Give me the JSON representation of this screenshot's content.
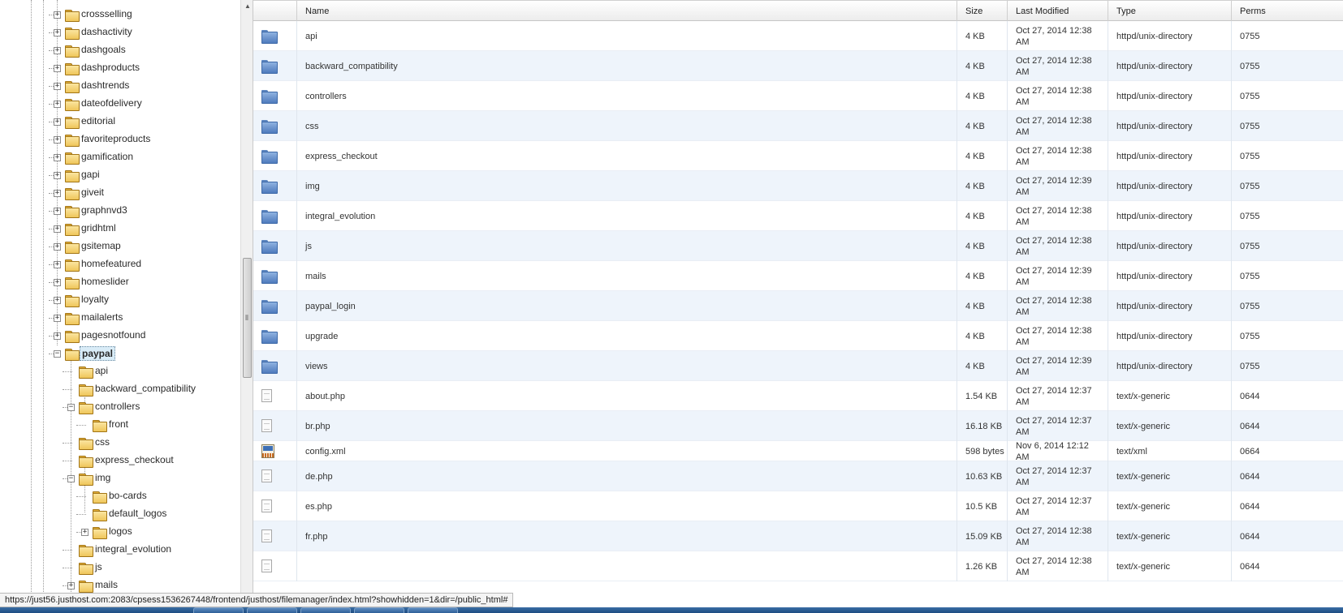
{
  "tree": {
    "items": [
      {
        "label": "crossselling",
        "state": "collapsed"
      },
      {
        "label": "dashactivity",
        "state": "collapsed"
      },
      {
        "label": "dashgoals",
        "state": "collapsed"
      },
      {
        "label": "dashproducts",
        "state": "collapsed"
      },
      {
        "label": "dashtrends",
        "state": "collapsed"
      },
      {
        "label": "dateofdelivery",
        "state": "collapsed"
      },
      {
        "label": "editorial",
        "state": "collapsed"
      },
      {
        "label": "favoriteproducts",
        "state": "collapsed"
      },
      {
        "label": "gamification",
        "state": "collapsed"
      },
      {
        "label": "gapi",
        "state": "collapsed"
      },
      {
        "label": "giveit",
        "state": "collapsed"
      },
      {
        "label": "graphnvd3",
        "state": "collapsed"
      },
      {
        "label": "gridhtml",
        "state": "collapsed"
      },
      {
        "label": "gsitemap",
        "state": "collapsed"
      },
      {
        "label": "homefeatured",
        "state": "collapsed"
      },
      {
        "label": "homeslider",
        "state": "collapsed"
      },
      {
        "label": "loyalty",
        "state": "collapsed"
      },
      {
        "label": "mailalerts",
        "state": "collapsed"
      },
      {
        "label": "pagesnotfound",
        "state": "collapsed"
      },
      {
        "label": "paypal",
        "state": "expanded",
        "selected": true
      },
      {
        "label": "api",
        "state": "leaf"
      },
      {
        "label": "backward_compatibility",
        "state": "leaf"
      },
      {
        "label": "controllers",
        "state": "expanded"
      },
      {
        "label": "front",
        "state": "leaf"
      },
      {
        "label": "css",
        "state": "leaf"
      },
      {
        "label": "express_checkout",
        "state": "leaf"
      },
      {
        "label": "img",
        "state": "expanded"
      },
      {
        "label": "bo-cards",
        "state": "leaf"
      },
      {
        "label": "default_logos",
        "state": "leaf"
      },
      {
        "label": "logos",
        "state": "collapsed"
      },
      {
        "label": "integral_evolution",
        "state": "leaf"
      },
      {
        "label": "js",
        "state": "leaf"
      },
      {
        "label": "mails",
        "state": "collapsed"
      }
    ]
  },
  "table": {
    "columns": {
      "name": "Name",
      "size": "Size",
      "modified": "Last Modified",
      "type": "Type",
      "perms": "Perms"
    },
    "rows": [
      {
        "icon": "blue-folder-icon",
        "name": "api",
        "size": "4 KB",
        "modified": "Oct 27, 2014 12:38 AM",
        "type": "httpd/unix-directory",
        "perms": "0755"
      },
      {
        "icon": "blue-folder-icon",
        "name": "backward_compatibility",
        "size": "4 KB",
        "modified": "Oct 27, 2014 12:38 AM",
        "type": "httpd/unix-directory",
        "perms": "0755"
      },
      {
        "icon": "blue-folder-icon",
        "name": "controllers",
        "size": "4 KB",
        "modified": "Oct 27, 2014 12:38 AM",
        "type": "httpd/unix-directory",
        "perms": "0755"
      },
      {
        "icon": "blue-folder-icon",
        "name": "css",
        "size": "4 KB",
        "modified": "Oct 27, 2014 12:38 AM",
        "type": "httpd/unix-directory",
        "perms": "0755"
      },
      {
        "icon": "blue-folder-icon",
        "name": "express_checkout",
        "size": "4 KB",
        "modified": "Oct 27, 2014 12:38 AM",
        "type": "httpd/unix-directory",
        "perms": "0755"
      },
      {
        "icon": "blue-folder-icon",
        "name": "img",
        "size": "4 KB",
        "modified": "Oct 27, 2014 12:39 AM",
        "type": "httpd/unix-directory",
        "perms": "0755"
      },
      {
        "icon": "blue-folder-icon",
        "name": "integral_evolution",
        "size": "4 KB",
        "modified": "Oct 27, 2014 12:38 AM",
        "type": "httpd/unix-directory",
        "perms": "0755"
      },
      {
        "icon": "blue-folder-icon",
        "name": "js",
        "size": "4 KB",
        "modified": "Oct 27, 2014 12:38 AM",
        "type": "httpd/unix-directory",
        "perms": "0755"
      },
      {
        "icon": "blue-folder-icon",
        "name": "mails",
        "size": "4 KB",
        "modified": "Oct 27, 2014 12:39 AM",
        "type": "httpd/unix-directory",
        "perms": "0755"
      },
      {
        "icon": "blue-folder-icon",
        "name": "paypal_login",
        "size": "4 KB",
        "modified": "Oct 27, 2014 12:38 AM",
        "type": "httpd/unix-directory",
        "perms": "0755"
      },
      {
        "icon": "blue-folder-icon",
        "name": "upgrade",
        "size": "4 KB",
        "modified": "Oct 27, 2014 12:38 AM",
        "type": "httpd/unix-directory",
        "perms": "0755"
      },
      {
        "icon": "blue-folder-icon",
        "name": "views",
        "size": "4 KB",
        "modified": "Oct 27, 2014 12:39 AM",
        "type": "httpd/unix-directory",
        "perms": "0755"
      },
      {
        "icon": "generic-file-icon",
        "name": "about.php",
        "size": "1.54 KB",
        "modified": "Oct 27, 2014 12:37 AM",
        "type": "text/x-generic",
        "perms": "0644"
      },
      {
        "icon": "generic-file-icon",
        "name": "br.php",
        "size": "16.18 KB",
        "modified": "Oct 27, 2014 12:37 AM",
        "type": "text/x-generic",
        "perms": "0644"
      },
      {
        "icon": "xml-file-icon",
        "name": "config.xml",
        "size": "598 bytes",
        "modified": "Nov 6, 2014 12:12 AM",
        "type": "text/xml",
        "perms": "0664",
        "short": true
      },
      {
        "icon": "generic-file-icon",
        "name": "de.php",
        "size": "10.63 KB",
        "modified": "Oct 27, 2014 12:37 AM",
        "type": "text/x-generic",
        "perms": "0644"
      },
      {
        "icon": "generic-file-icon",
        "name": "es.php",
        "size": "10.5 KB",
        "modified": "Oct 27, 2014 12:37 AM",
        "type": "text/x-generic",
        "perms": "0644"
      },
      {
        "icon": "generic-file-icon",
        "name": "fr.php",
        "size": "15.09 KB",
        "modified": "Oct 27, 2014 12:38 AM",
        "type": "text/x-generic",
        "perms": "0644"
      },
      {
        "icon": "generic-file-icon",
        "name": "",
        "size": "1.26 KB",
        "modified": "Oct 27, 2014 12:38 AM",
        "type": "text/x-generic",
        "perms": "0644"
      }
    ]
  },
  "statusbar": {
    "url": "https://just56.justhost.com:2083/cpsess1536267448/frontend/justhost/filemanager/index.html?showhidden=1&dir=/public_html#"
  },
  "colors": {
    "row_alt": "#eef4fb",
    "selection": "#d9ecf7",
    "folder_yellow": "#efc65a",
    "folder_blue": "#4f7bbd"
  }
}
